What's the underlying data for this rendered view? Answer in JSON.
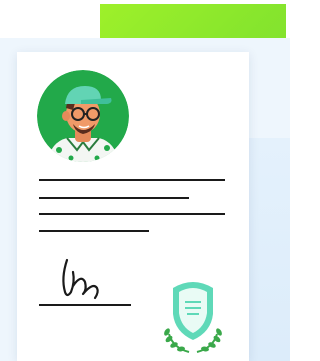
{
  "illustration": {
    "subject": "signed-certificate-document",
    "icons": [
      "person-avatar-icon",
      "signature-icon",
      "badge-seal-icon"
    ],
    "colors": {
      "accent_green": "#8ee62c",
      "avatar_bg": "#22a94a",
      "seal_mint": "#5fd9b8",
      "laurel_green": "#3aa84a",
      "haze_blue": "#eef6fd",
      "ink": "#1a1a1a"
    },
    "text_lines": 4
  }
}
